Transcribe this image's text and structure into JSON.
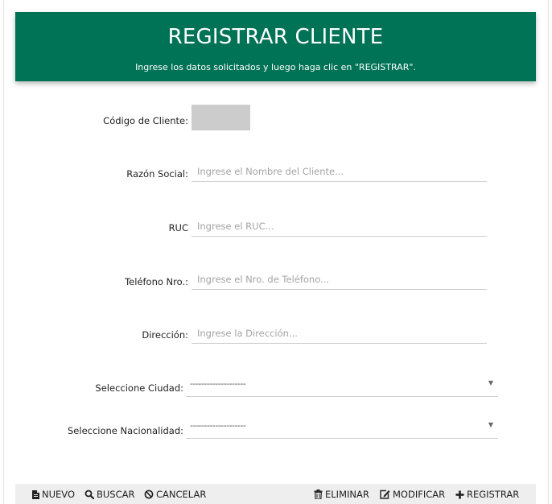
{
  "header": {
    "title": "REGISTRAR CLIENTE",
    "subtitle": "Ingrese los datos solicitados y luego haga clic en \"REGISTRAR\"."
  },
  "form": {
    "codigo_label": "Código de Cliente:",
    "razon_label": "Razón Social:",
    "razon_placeholder": "Ingrese el Nombre del Cliente...",
    "ruc_label": "RUC",
    "ruc_placeholder": "Ingrese el RUC...",
    "telefono_label": "Teléfono Nro.:",
    "telefono_placeholder": "Ingrese el Nro. de Teléfono...",
    "direccion_label": "Dirección:",
    "direccion_placeholder": "Ingrese la Dirección...",
    "ciudad_label": "Seleccione Ciudad:",
    "ciudad_value": "--------------------",
    "nacionalidad_label": "Seleccione Nacionalidad:",
    "nacionalidad_value": "--------------------"
  },
  "toolbar": {
    "nuevo": "NUEVO",
    "buscar": "BUSCAR",
    "cancelar": "CANCELAR",
    "eliminar": "ELIMINAR",
    "modificar": "MODIFICAR",
    "registrar": "REGISTRAR"
  },
  "colors": {
    "header_bg": "#007256",
    "toolbar_bg": "#eeeeee"
  },
  "icons": {
    "nuevo": "file-icon",
    "buscar": "search-icon",
    "cancelar": "ban-icon",
    "eliminar": "trash-icon",
    "modificar": "edit-icon",
    "registrar": "plus-icon",
    "select_arrow": "caret-down-icon"
  }
}
